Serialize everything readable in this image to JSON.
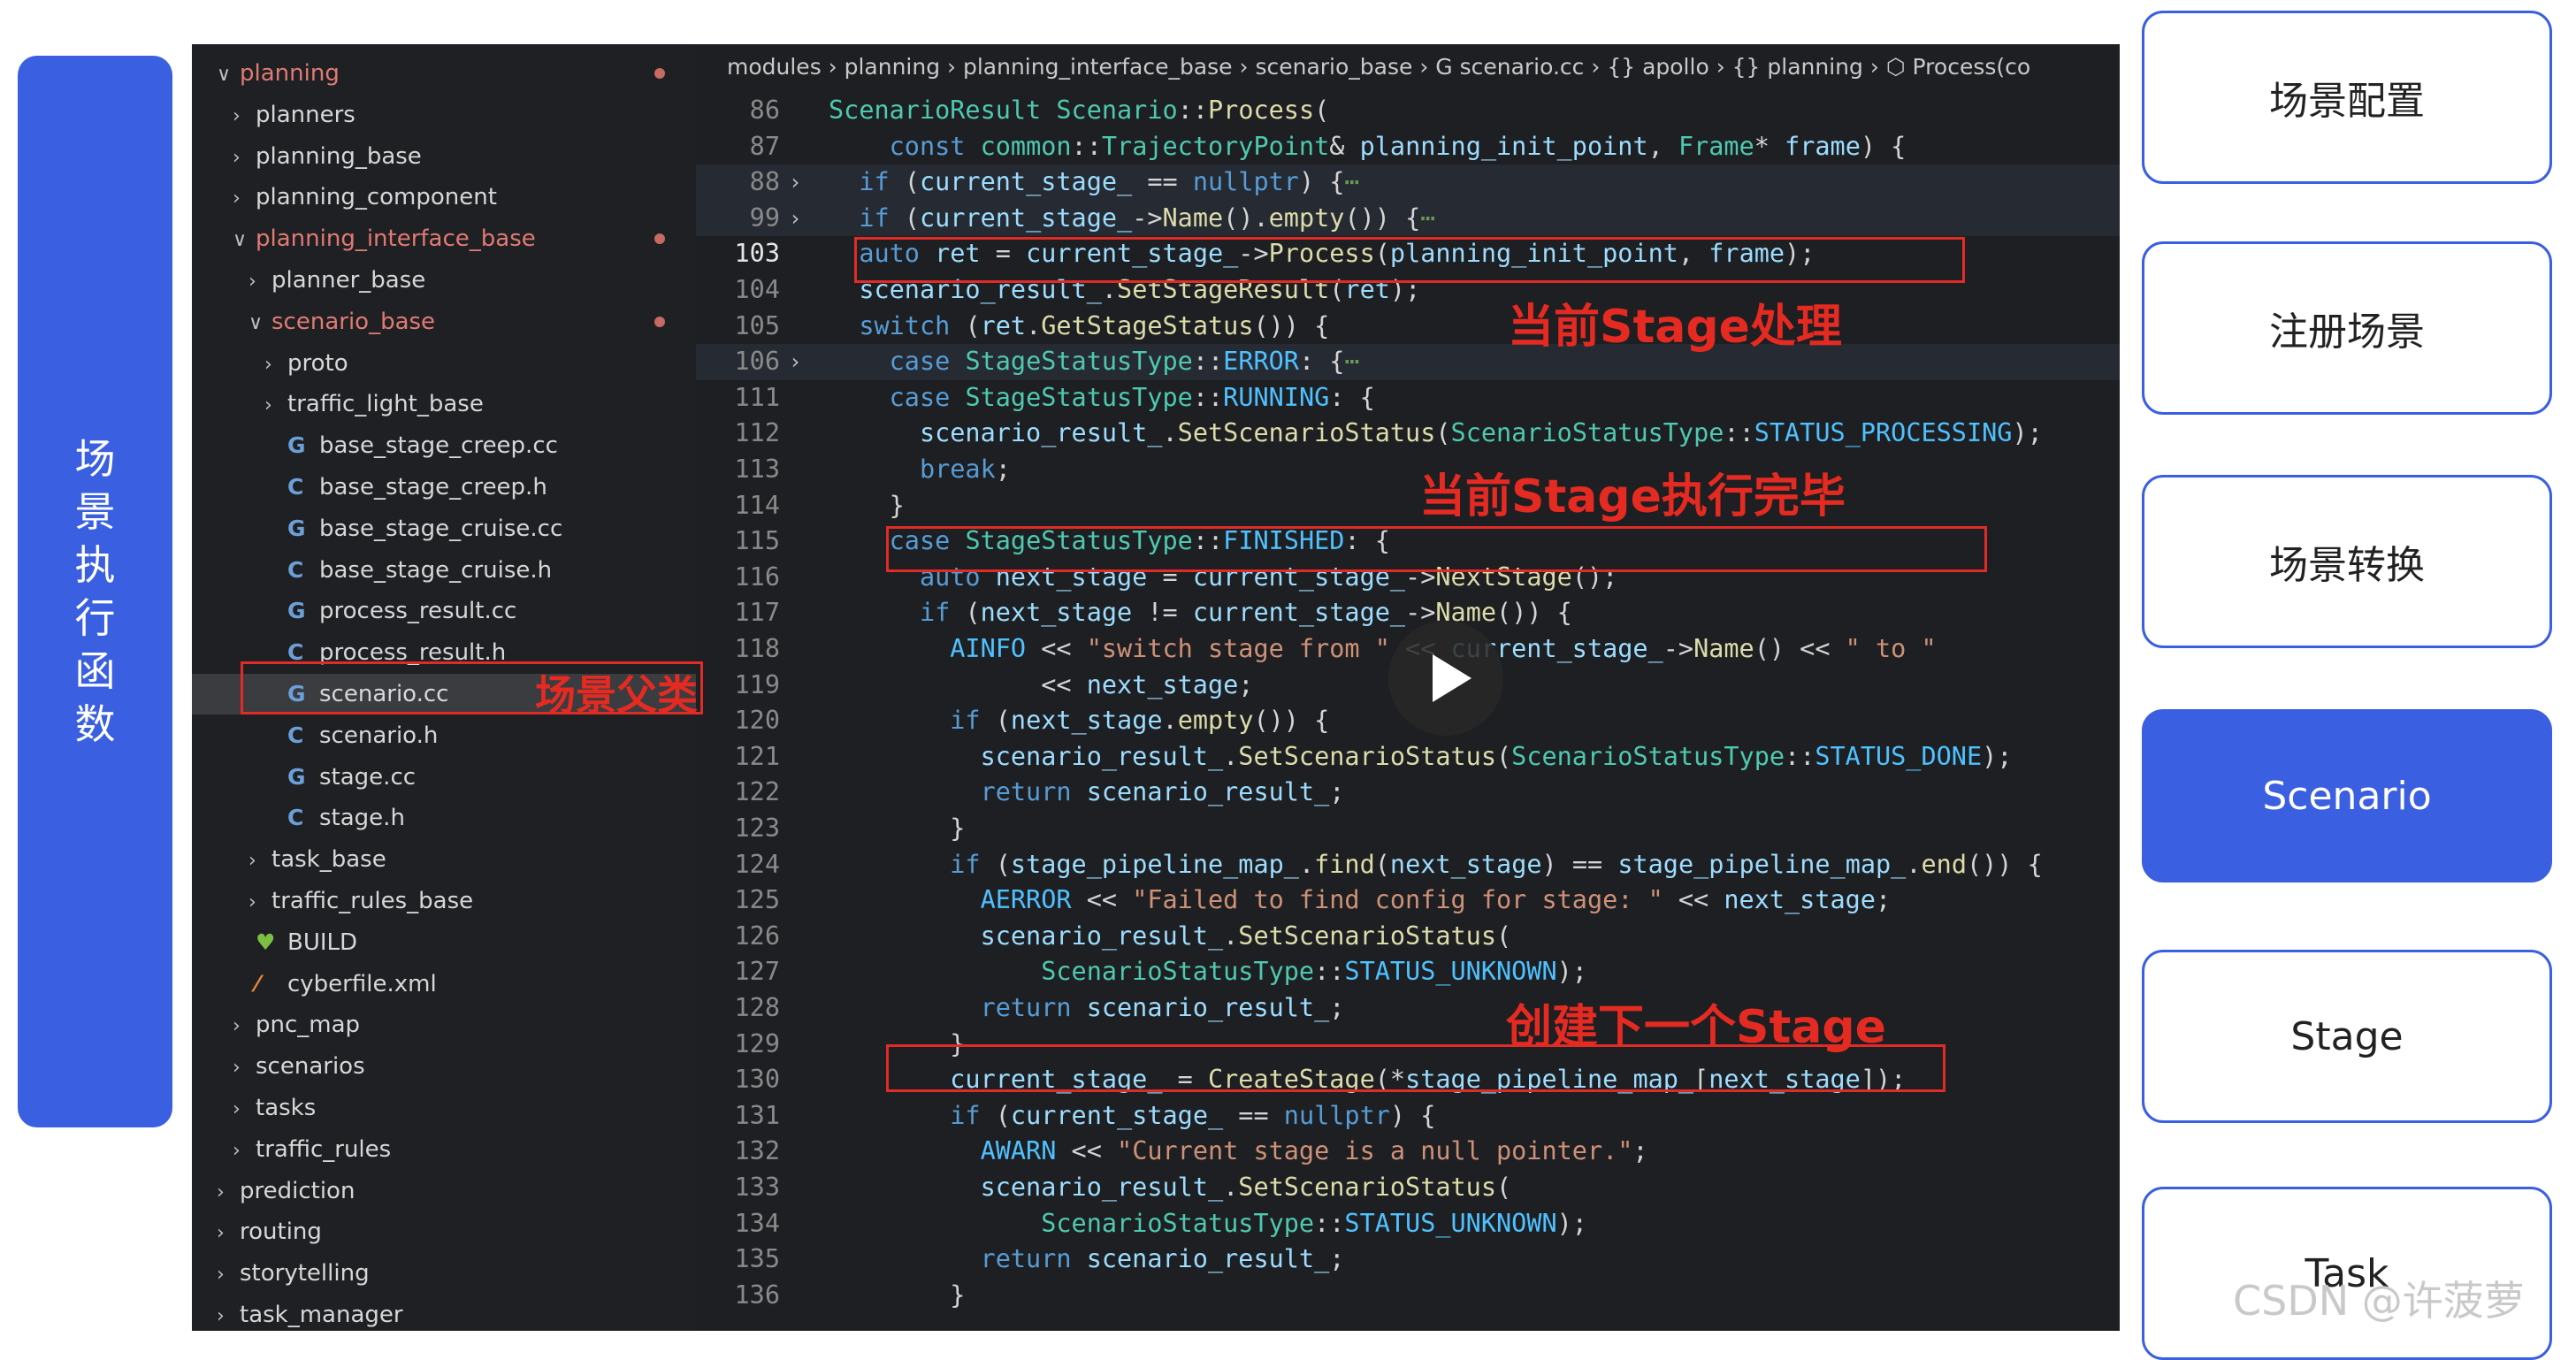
{
  "left_label": "场景执行函数",
  "explorer": {
    "rows": [
      {
        "label": "planning",
        "chev": "∨",
        "icon": "",
        "red": true,
        "dot": true
      },
      {
        "label": "planners",
        "chev": "›",
        "icon": ""
      },
      {
        "label": "planning_base",
        "chev": "›",
        "icon": ""
      },
      {
        "label": "planning_component",
        "chev": "›",
        "icon": ""
      },
      {
        "label": "planning_interface_base",
        "chev": "∨",
        "icon": "",
        "red": true,
        "dot": true
      },
      {
        "label": "planner_base",
        "chev": "›",
        "icon": ""
      },
      {
        "label": "scenario_base",
        "chev": "∨",
        "icon": "",
        "red": true,
        "dot": true
      },
      {
        "label": "proto",
        "chev": "›",
        "icon": ""
      },
      {
        "label": "traffic_light_base",
        "chev": "›",
        "icon": ""
      },
      {
        "label": "base_stage_creep.cc",
        "chev": "",
        "icon": "G"
      },
      {
        "label": "base_stage_creep.h",
        "chev": "",
        "icon": "C"
      },
      {
        "label": "base_stage_cruise.cc",
        "chev": "",
        "icon": "G"
      },
      {
        "label": "base_stage_cruise.h",
        "chev": "",
        "icon": "C"
      },
      {
        "label": "process_result.cc",
        "chev": "",
        "icon": "G"
      },
      {
        "label": "process_result.h",
        "chev": "",
        "icon": "C"
      },
      {
        "label": "scenario.cc",
        "chev": "",
        "icon": "G",
        "selected": true
      },
      {
        "label": "scenario.h",
        "chev": "",
        "icon": "C"
      },
      {
        "label": "stage.cc",
        "chev": "",
        "icon": "G"
      },
      {
        "label": "stage.h",
        "chev": "",
        "icon": "C"
      },
      {
        "label": "task_base",
        "chev": "›",
        "icon": ""
      },
      {
        "label": "traffic_rules_base",
        "chev": "›",
        "icon": ""
      },
      {
        "label": "BUILD",
        "chev": "",
        "icon": "♥"
      },
      {
        "label": "cyberfile.xml",
        "chev": "",
        "icon": "⁄"
      },
      {
        "label": "pnc_map",
        "chev": "›",
        "icon": ""
      },
      {
        "label": "scenarios",
        "chev": "›",
        "icon": ""
      },
      {
        "label": "tasks",
        "chev": "›",
        "icon": ""
      },
      {
        "label": "traffic_rules",
        "chev": "›",
        "icon": ""
      },
      {
        "label": "prediction",
        "chev": "›",
        "icon": ""
      },
      {
        "label": "routing",
        "chev": "›",
        "icon": ""
      },
      {
        "label": "storytelling",
        "chev": "›",
        "icon": ""
      },
      {
        "label": "task_manager",
        "chev": "›",
        "icon": ""
      }
    ]
  },
  "breadcrumb": "modules › planning › planning_interface_base › scenario_base › G scenario.cc › {} apollo › {} planning › ⬡ Process(co",
  "code_lines": [
    {
      "n": "86",
      "fold": "",
      "tokens": [
        [
          "ScenarioResult ",
          "ty"
        ],
        [
          "Scenario",
          "ty"
        ],
        [
          "::",
          "pl"
        ],
        [
          "Process",
          "fn"
        ],
        [
          "(",
          "pl"
        ]
      ]
    },
    {
      "n": "87",
      "fold": "",
      "tokens": [
        [
          "    const ",
          "kw"
        ],
        [
          "common",
          "ty"
        ],
        [
          "::",
          "pl"
        ],
        [
          "TrajectoryPoint",
          "ty"
        ],
        [
          "& ",
          "pl"
        ],
        [
          "planning_init_point",
          "var"
        ],
        [
          ", ",
          "pl"
        ],
        [
          "Frame",
          "ty"
        ],
        [
          "* ",
          "pl"
        ],
        [
          "frame",
          "var"
        ],
        [
          ") {",
          "pl"
        ]
      ]
    },
    {
      "n": "88",
      "fold": "›",
      "hl": true,
      "tokens": [
        [
          "  if ",
          "kw"
        ],
        [
          "(",
          "pl"
        ],
        [
          "current_stage_",
          "var"
        ],
        [
          " == ",
          "pl"
        ],
        [
          "nullptr",
          "kw"
        ],
        [
          ") {",
          "pl"
        ],
        [
          "⋯",
          "cm"
        ]
      ]
    },
    {
      "n": "99",
      "fold": "›",
      "hl": true,
      "tokens": [
        [
          "  if ",
          "kw"
        ],
        [
          "(",
          "pl"
        ],
        [
          "current_stage_",
          "var"
        ],
        [
          "->",
          "pl"
        ],
        [
          "Name",
          "fn"
        ],
        [
          "().",
          "pl"
        ],
        [
          "empty",
          "fn"
        ],
        [
          "()) {",
          "pl"
        ],
        [
          "⋯",
          "cm"
        ]
      ]
    },
    {
      "n": "103",
      "fold": "",
      "tokens": [
        [
          "  auto ",
          "kw"
        ],
        [
          "ret",
          "var"
        ],
        [
          " = ",
          "pl"
        ],
        [
          "current_stage_",
          "var"
        ],
        [
          "->",
          "pl"
        ],
        [
          "Process",
          "fn"
        ],
        [
          "(",
          "pl"
        ],
        [
          "planning_init_point",
          "var"
        ],
        [
          ", ",
          "pl"
        ],
        [
          "frame",
          "var"
        ],
        [
          ");",
          "pl"
        ]
      ]
    },
    {
      "n": "104",
      "fold": "",
      "tokens": [
        [
          "  scenario_result_",
          "var"
        ],
        [
          ".",
          "pl"
        ],
        [
          "SetStageResult",
          "fn"
        ],
        [
          "(",
          "pl"
        ],
        [
          "ret",
          "var"
        ],
        [
          ");",
          "pl"
        ]
      ]
    },
    {
      "n": "105",
      "fold": "",
      "tokens": [
        [
          "  switch ",
          "kw"
        ],
        [
          "(",
          "pl"
        ],
        [
          "ret",
          "var"
        ],
        [
          ".",
          "pl"
        ],
        [
          "GetStageStatus",
          "fn"
        ],
        [
          "()) {",
          "pl"
        ]
      ]
    },
    {
      "n": "106",
      "fold": "›",
      "hl": true,
      "tokens": [
        [
          "    case ",
          "kw"
        ],
        [
          "StageStatusType",
          "ty"
        ],
        [
          "::",
          "pl"
        ],
        [
          "ERROR",
          "mac"
        ],
        [
          ": {",
          "pl"
        ],
        [
          "⋯",
          "cm"
        ]
      ]
    },
    {
      "n": "111",
      "fold": "",
      "tokens": [
        [
          "    case ",
          "kw"
        ],
        [
          "StageStatusType",
          "ty"
        ],
        [
          "::",
          "pl"
        ],
        [
          "RUNNING",
          "mac"
        ],
        [
          ": {",
          "pl"
        ]
      ]
    },
    {
      "n": "112",
      "fold": "",
      "tokens": [
        [
          "      scenario_result_",
          "var"
        ],
        [
          ".",
          "pl"
        ],
        [
          "SetScenarioStatus",
          "fn"
        ],
        [
          "(",
          "pl"
        ],
        [
          "ScenarioStatusType",
          "ty"
        ],
        [
          "::",
          "pl"
        ],
        [
          "STATUS_PROCESSING",
          "mac"
        ],
        [
          ");",
          "pl"
        ]
      ]
    },
    {
      "n": "113",
      "fold": "",
      "tokens": [
        [
          "      break",
          "kw"
        ],
        [
          ";",
          "pl"
        ]
      ]
    },
    {
      "n": "114",
      "fold": "",
      "tokens": [
        [
          "    }",
          "pl"
        ]
      ]
    },
    {
      "n": "115",
      "fold": "",
      "tokens": [
        [
          "    case ",
          "kw"
        ],
        [
          "StageStatusType",
          "ty"
        ],
        [
          "::",
          "pl"
        ],
        [
          "FINISHED",
          "mac"
        ],
        [
          ": {",
          "pl"
        ]
      ]
    },
    {
      "n": "116",
      "fold": "",
      "tokens": [
        [
          "      auto ",
          "kw"
        ],
        [
          "next_stage",
          "var"
        ],
        [
          " = ",
          "pl"
        ],
        [
          "current_stage_",
          "var"
        ],
        [
          "->",
          "pl"
        ],
        [
          "NextStage",
          "fn"
        ],
        [
          "();",
          "pl"
        ]
      ]
    },
    {
      "n": "117",
      "fold": "",
      "tokens": [
        [
          "      if ",
          "kw"
        ],
        [
          "(",
          "pl"
        ],
        [
          "next_stage",
          "var"
        ],
        [
          " != ",
          "pl"
        ],
        [
          "current_stage_",
          "var"
        ],
        [
          "->",
          "pl"
        ],
        [
          "Name",
          "fn"
        ],
        [
          "()) {",
          "pl"
        ]
      ]
    },
    {
      "n": "118",
      "fold": "",
      "tokens": [
        [
          "        AINFO ",
          "mac"
        ],
        [
          "<< ",
          "pl"
        ],
        [
          "\"switch stage from \"",
          "str"
        ],
        [
          " << ",
          "pl"
        ],
        [
          "current_stage_",
          "var"
        ],
        [
          "->",
          "pl"
        ],
        [
          "Name",
          "fn"
        ],
        [
          "() << ",
          "pl"
        ],
        [
          "\" to \"",
          "str"
        ]
      ]
    },
    {
      "n": "119",
      "fold": "",
      "tokens": [
        [
          "              << ",
          "pl"
        ],
        [
          "next_stage",
          "var"
        ],
        [
          ";",
          "pl"
        ]
      ]
    },
    {
      "n": "120",
      "fold": "",
      "tokens": [
        [
          "        if ",
          "kw"
        ],
        [
          "(",
          "pl"
        ],
        [
          "next_stage",
          "var"
        ],
        [
          ".",
          "pl"
        ],
        [
          "empty",
          "fn"
        ],
        [
          "()) {",
          "pl"
        ]
      ]
    },
    {
      "n": "121",
      "fold": "",
      "tokens": [
        [
          "          scenario_result_",
          "var"
        ],
        [
          ".",
          "pl"
        ],
        [
          "SetScenarioStatus",
          "fn"
        ],
        [
          "(",
          "pl"
        ],
        [
          "ScenarioStatusType",
          "ty"
        ],
        [
          "::",
          "pl"
        ],
        [
          "STATUS_DONE",
          "mac"
        ],
        [
          ");",
          "pl"
        ]
      ]
    },
    {
      "n": "122",
      "fold": "",
      "tokens": [
        [
          "          return ",
          "kw"
        ],
        [
          "scenario_result_",
          "var"
        ],
        [
          ";",
          "pl"
        ]
      ]
    },
    {
      "n": "123",
      "fold": "",
      "tokens": [
        [
          "        }",
          "pl"
        ]
      ]
    },
    {
      "n": "124",
      "fold": "",
      "tokens": [
        [
          "        if ",
          "kw"
        ],
        [
          "(",
          "pl"
        ],
        [
          "stage_pipeline_map_",
          "var"
        ],
        [
          ".",
          "pl"
        ],
        [
          "find",
          "fn"
        ],
        [
          "(",
          "pl"
        ],
        [
          "next_stage",
          "var"
        ],
        [
          ") == ",
          "pl"
        ],
        [
          "stage_pipeline_map_",
          "var"
        ],
        [
          ".",
          "pl"
        ],
        [
          "end",
          "fn"
        ],
        [
          "()) {",
          "pl"
        ]
      ]
    },
    {
      "n": "125",
      "fold": "",
      "tokens": [
        [
          "          AERROR ",
          "mac"
        ],
        [
          "<< ",
          "pl"
        ],
        [
          "\"Failed to find config for stage: \"",
          "str"
        ],
        [
          " << ",
          "pl"
        ],
        [
          "next_stage",
          "var"
        ],
        [
          ";",
          "pl"
        ]
      ]
    },
    {
      "n": "126",
      "fold": "",
      "tokens": [
        [
          "          scenario_result_",
          "var"
        ],
        [
          ".",
          "pl"
        ],
        [
          "SetScenarioStatus",
          "fn"
        ],
        [
          "(",
          "pl"
        ]
      ]
    },
    {
      "n": "127",
      "fold": "",
      "tokens": [
        [
          "              ScenarioStatusType",
          "ty"
        ],
        [
          "::",
          "pl"
        ],
        [
          "STATUS_UNKNOWN",
          "mac"
        ],
        [
          ");",
          "pl"
        ]
      ]
    },
    {
      "n": "128",
      "fold": "",
      "tokens": [
        [
          "          return ",
          "kw"
        ],
        [
          "scenario_result_",
          "var"
        ],
        [
          ";",
          "pl"
        ]
      ]
    },
    {
      "n": "129",
      "fold": "",
      "tokens": [
        [
          "        }",
          "pl"
        ]
      ]
    },
    {
      "n": "130",
      "fold": "",
      "tokens": [
        [
          "        current_stage_",
          "var"
        ],
        [
          " = ",
          "pl"
        ],
        [
          "CreateStage",
          "fn"
        ],
        [
          "(*",
          "pl"
        ],
        [
          "stage_pipeline_map_",
          "var"
        ],
        [
          "[",
          "pl"
        ],
        [
          "next_stage",
          "var"
        ],
        [
          "]);",
          "pl"
        ]
      ]
    },
    {
      "n": "131",
      "fold": "",
      "tokens": [
        [
          "        if ",
          "kw"
        ],
        [
          "(",
          "pl"
        ],
        [
          "current_stage_",
          "var"
        ],
        [
          " == ",
          "pl"
        ],
        [
          "nullptr",
          "kw"
        ],
        [
          ") {",
          "pl"
        ]
      ]
    },
    {
      "n": "132",
      "fold": "",
      "tokens": [
        [
          "          AWARN ",
          "mac"
        ],
        [
          "<< ",
          "pl"
        ],
        [
          "\"Current stage is a null pointer.\"",
          "str"
        ],
        [
          ";",
          "pl"
        ]
      ]
    },
    {
      "n": "133",
      "fold": "",
      "tokens": [
        [
          "          scenario_result_",
          "var"
        ],
        [
          ".",
          "pl"
        ],
        [
          "SetScenarioStatus",
          "fn"
        ],
        [
          "(",
          "pl"
        ]
      ]
    },
    {
      "n": "134",
      "fold": "",
      "tokens": [
        [
          "              ScenarioStatusType",
          "ty"
        ],
        [
          "::",
          "pl"
        ],
        [
          "STATUS_UNKNOWN",
          "mac"
        ],
        [
          ");",
          "pl"
        ]
      ]
    },
    {
      "n": "135",
      "fold": "",
      "tokens": [
        [
          "          return ",
          "kw"
        ],
        [
          "scenario_result_",
          "var"
        ],
        [
          ";",
          "pl"
        ]
      ]
    },
    {
      "n": "136",
      "fold": "",
      "tokens": [
        [
          "        }",
          "pl"
        ]
      ]
    }
  ],
  "annotations": {
    "scenario_parent": "场景父类",
    "current_stage_process": "当前Stage处理",
    "current_stage_finished": "当前Stage执行完毕",
    "create_next_stage": "创建下一个Stage"
  },
  "nav_cards": [
    {
      "label": "场景配置",
      "active": false
    },
    {
      "label": "注册场景",
      "active": false
    },
    {
      "label": "场景转换",
      "active": false
    },
    {
      "label": "Scenario",
      "active": true
    },
    {
      "label": "Stage",
      "active": false
    },
    {
      "label": "Task",
      "active": false
    }
  ],
  "watermark": "CSDN @许菠萝",
  "colors": {
    "accent": "#3a5fe0",
    "annotation_red": "#e52a22",
    "editor_bg": "#1e1f22"
  }
}
